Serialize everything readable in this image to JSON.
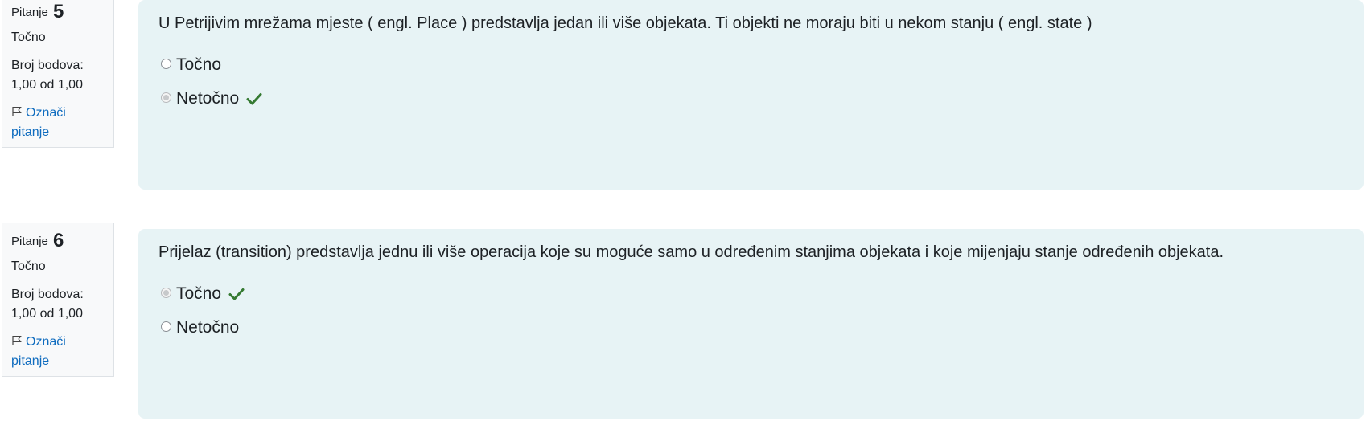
{
  "questions": [
    {
      "prefix": "Pitanje",
      "number": "5",
      "state": "Točno",
      "grade_label": "Broj bodova:",
      "grade_value": "1,00 od 1,00",
      "flag_label_1": "Označi",
      "flag_label_2": "pitanje",
      "text": "U Petrijivim mrežama mjeste ( engl. Place ) predstavlja jedan ili više objekata. Ti objekti ne moraju biti u nekom stanju ( engl. state )",
      "options": [
        {
          "label": "Točno",
          "selected": false,
          "correct": false
        },
        {
          "label": "Netočno",
          "selected": true,
          "correct": true
        }
      ]
    },
    {
      "prefix": "Pitanje",
      "number": "6",
      "state": "Točno",
      "grade_label": "Broj bodova:",
      "grade_value": "1,00 od 1,00",
      "flag_label_1": "Označi",
      "flag_label_2": "pitanje",
      "text": "Prijelaz (transition) predstavlja jednu ili više operacija koje su moguće samo u određenim stanjima objekata i koje mijenjaju stanje određenih objekata.",
      "options": [
        {
          "label": "Točno",
          "selected": true,
          "correct": true
        },
        {
          "label": "Netočno",
          "selected": false,
          "correct": false
        }
      ]
    }
  ],
  "colors": {
    "accent": "#0f6cbf",
    "correct_check": "#357a32",
    "content_bg": "#e7f3f5",
    "info_bg": "#f8f9fa"
  }
}
